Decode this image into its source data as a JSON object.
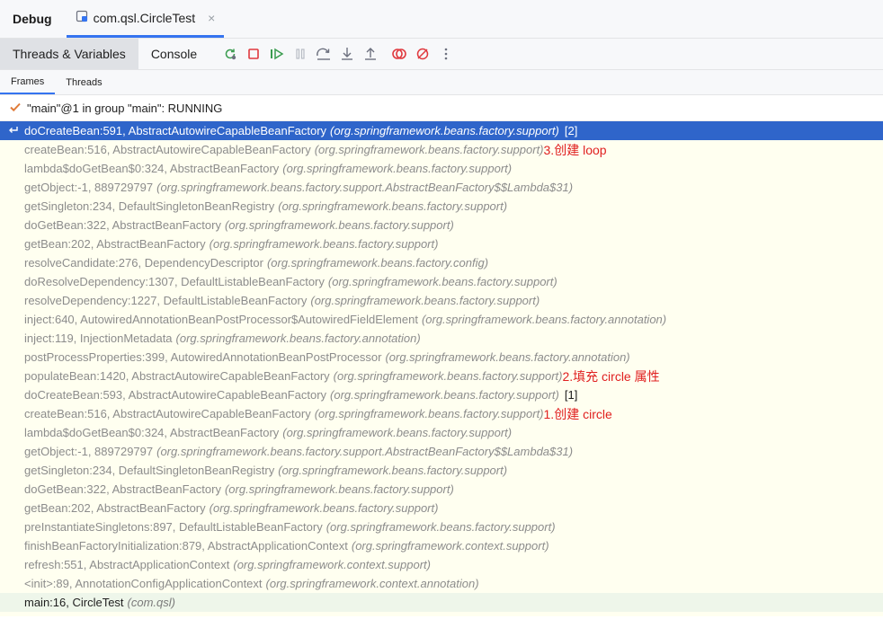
{
  "header": {
    "panel_title": "Debug",
    "file_tab": "com.qsl.CircleTest",
    "close_glyph": "×"
  },
  "toolbar": {
    "tabs": [
      "Threads & Variables",
      "Console"
    ],
    "icons": [
      "rerun-icon",
      "stop-icon",
      "resume-icon",
      "pause-icon",
      "step-over-icon",
      "step-into-icon",
      "step-out-icon",
      "view-breakpoints-icon",
      "mute-breakpoints-icon",
      "more-icon"
    ]
  },
  "subtabs": [
    "Frames",
    "Threads"
  ],
  "thread": {
    "label": "\"main\"@1 in group \"main\": RUNNING"
  },
  "frames": [
    {
      "method": "doCreateBean:591, AbstractAutowireCapableBeanFactory",
      "pkg": "(org.springframework.beans.factory.support)",
      "tag": "[2]",
      "note": ""
    },
    {
      "method": "createBean:516, AbstractAutowireCapableBeanFactory",
      "pkg": "(org.springframework.beans.factory.support)",
      "tag": "",
      "note": "3.创建 loop"
    },
    {
      "method": "lambda$doGetBean$0:324, AbstractBeanFactory",
      "pkg": "(org.springframework.beans.factory.support)",
      "tag": "",
      "note": ""
    },
    {
      "method": "getObject:-1, 889729797",
      "pkg": "(org.springframework.beans.factory.support.AbstractBeanFactory$$Lambda$31)",
      "tag": "",
      "note": ""
    },
    {
      "method": "getSingleton:234, DefaultSingletonBeanRegistry",
      "pkg": "(org.springframework.beans.factory.support)",
      "tag": "",
      "note": ""
    },
    {
      "method": "doGetBean:322, AbstractBeanFactory",
      "pkg": "(org.springframework.beans.factory.support)",
      "tag": "",
      "note": ""
    },
    {
      "method": "getBean:202, AbstractBeanFactory",
      "pkg": "(org.springframework.beans.factory.support)",
      "tag": "",
      "note": ""
    },
    {
      "method": "resolveCandidate:276, DependencyDescriptor",
      "pkg": "(org.springframework.beans.factory.config)",
      "tag": "",
      "note": ""
    },
    {
      "method": "doResolveDependency:1307, DefaultListableBeanFactory",
      "pkg": "(org.springframework.beans.factory.support)",
      "tag": "",
      "note": ""
    },
    {
      "method": "resolveDependency:1227, DefaultListableBeanFactory",
      "pkg": "(org.springframework.beans.factory.support)",
      "tag": "",
      "note": ""
    },
    {
      "method": "inject:640, AutowiredAnnotationBeanPostProcessor$AutowiredFieldElement",
      "pkg": "(org.springframework.beans.factory.annotation)",
      "tag": "",
      "note": ""
    },
    {
      "method": "inject:119, InjectionMetadata",
      "pkg": "(org.springframework.beans.factory.annotation)",
      "tag": "",
      "note": ""
    },
    {
      "method": "postProcessProperties:399, AutowiredAnnotationBeanPostProcessor",
      "pkg": "(org.springframework.beans.factory.annotation)",
      "tag": "",
      "note": ""
    },
    {
      "method": "populateBean:1420, AbstractAutowireCapableBeanFactory",
      "pkg": "(org.springframework.beans.factory.support)",
      "tag": "",
      "note": "2.填充 circle 属性"
    },
    {
      "method": "doCreateBean:593, AbstractAutowireCapableBeanFactory",
      "pkg": "(org.springframework.beans.factory.support)",
      "tag": "[1]",
      "note": ""
    },
    {
      "method": "createBean:516, AbstractAutowireCapableBeanFactory",
      "pkg": "(org.springframework.beans.factory.support)",
      "tag": "",
      "note": "1.创建 circle"
    },
    {
      "method": "lambda$doGetBean$0:324, AbstractBeanFactory",
      "pkg": "(org.springframework.beans.factory.support)",
      "tag": "",
      "note": ""
    },
    {
      "method": "getObject:-1, 889729797",
      "pkg": "(org.springframework.beans.factory.support.AbstractBeanFactory$$Lambda$31)",
      "tag": "",
      "note": ""
    },
    {
      "method": "getSingleton:234, DefaultSingletonBeanRegistry",
      "pkg": "(org.springframework.beans.factory.support)",
      "tag": "",
      "note": ""
    },
    {
      "method": "doGetBean:322, AbstractBeanFactory",
      "pkg": "(org.springframework.beans.factory.support)",
      "tag": "",
      "note": ""
    },
    {
      "method": "getBean:202, AbstractBeanFactory",
      "pkg": "(org.springframework.beans.factory.support)",
      "tag": "",
      "note": ""
    },
    {
      "method": "preInstantiateSingletons:897, DefaultListableBeanFactory",
      "pkg": "(org.springframework.beans.factory.support)",
      "tag": "",
      "note": ""
    },
    {
      "method": "finishBeanFactoryInitialization:879, AbstractApplicationContext",
      "pkg": "(org.springframework.context.support)",
      "tag": "",
      "note": ""
    },
    {
      "method": "refresh:551, AbstractApplicationContext",
      "pkg": "(org.springframework.context.support)",
      "tag": "",
      "note": ""
    },
    {
      "method": "<init>:89, AnnotationConfigApplicationContext",
      "pkg": "(org.springframework.context.annotation)",
      "tag": "",
      "note": ""
    },
    {
      "method": "main:16, CircleTest",
      "pkg": "(com.qsl)",
      "tag": "",
      "note": ""
    }
  ],
  "colors": {
    "selection": "#2f65ca",
    "accent": "#3574f0",
    "annotation": "#e01f1f",
    "frames_bg": "#fffff0"
  }
}
